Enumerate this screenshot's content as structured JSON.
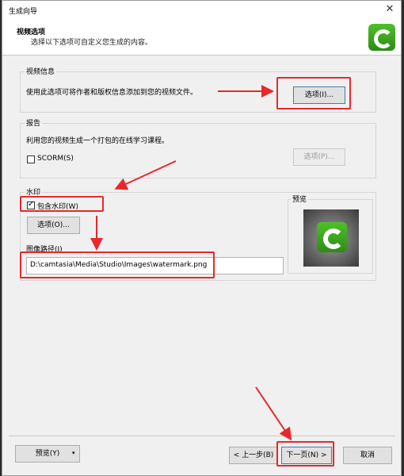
{
  "window": {
    "title": "生成向导",
    "close_glyph": "✕"
  },
  "header": {
    "title": "视频选项",
    "subtitle": "选择以下选项可自定义您生成的内容。"
  },
  "video_info": {
    "group_label": "视频信息",
    "description": "使用此选项可将作者和版权信息添加到您的视频文件。",
    "options_button": "选项(I)..."
  },
  "report": {
    "group_label": "报告",
    "description": "利用您的视频生成一个打包的在线学习课程。",
    "scorm_label": "SCORM(S)",
    "scorm_checked": false,
    "options_button": "选项(P)..."
  },
  "watermark": {
    "group_label": "水印",
    "include_label": "包含水印(W)",
    "include_checked": true,
    "options_button": "选项(O)...",
    "image_path_label": "图像路径(I)",
    "image_path": "D:\\camtasia\\Media\\Studio\\Images\\watermark.png",
    "preview_label": "预览"
  },
  "footer": {
    "preview_button": "预览(Y)",
    "back_button": "< 上一步(B)",
    "next_button": "下一页(N) >",
    "cancel_button": "取消"
  },
  "colors": {
    "annotation": "#e8282a",
    "logo_green": "#3aa820"
  }
}
